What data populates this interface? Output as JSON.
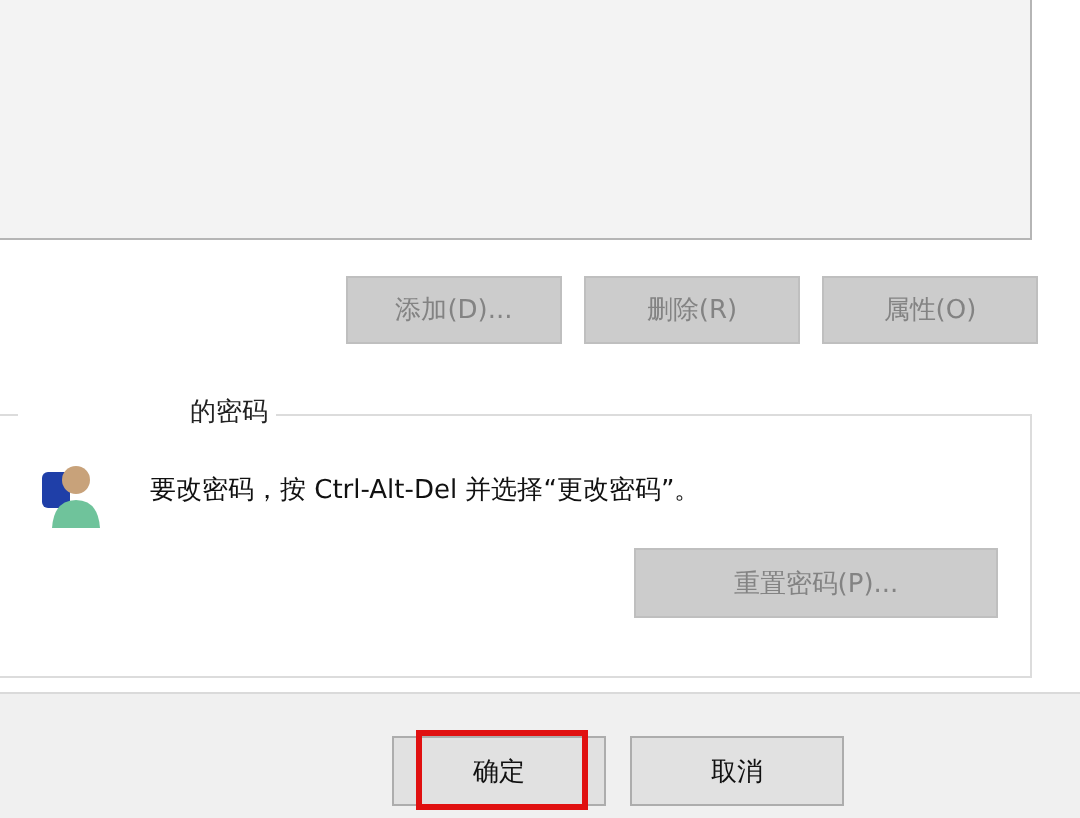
{
  "user_buttons": [
    {
      "label": "添加(D)...",
      "disabled": true
    },
    {
      "label": "删除(R)",
      "disabled": true
    },
    {
      "label": "属性(O)",
      "disabled": true
    }
  ],
  "password_group": {
    "title": "的密码",
    "message": "要改密码，按 Ctrl-Alt-Del 并选择“更改密码”。",
    "reset_button": {
      "label": "重置密码(P)...",
      "disabled": true
    }
  },
  "footer_buttons": [
    {
      "label": "确定",
      "highlighted": true
    },
    {
      "label": "取消",
      "highlighted": false
    }
  ]
}
